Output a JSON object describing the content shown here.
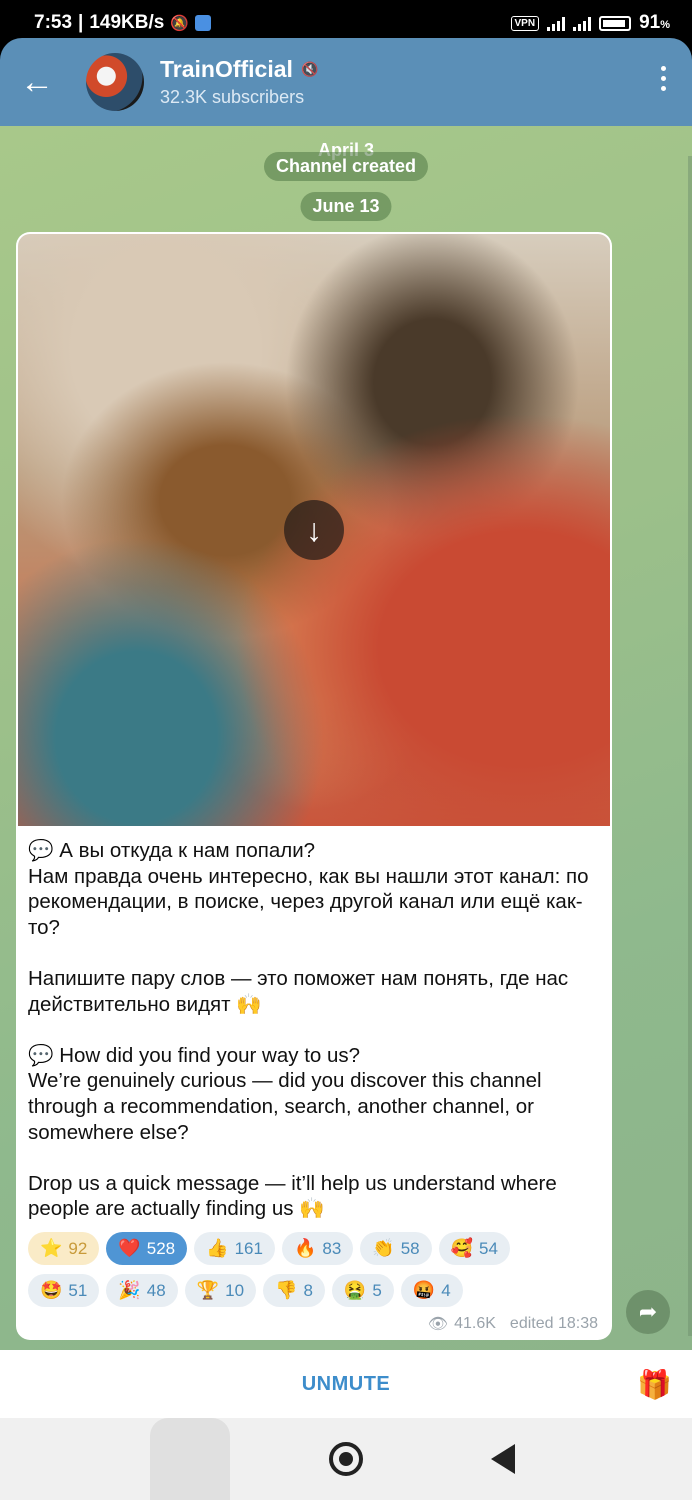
{
  "status_bar": {
    "time": "7:53",
    "speed": "149KB/s",
    "vpn": "VPN",
    "battery": "91"
  },
  "header": {
    "back_icon": "arrow-left-icon",
    "channel_name": "TrainOfficial",
    "subscribers": "32.3K subscribers",
    "menu_icon": "more-vert-icon"
  },
  "chat": {
    "service_1": "April 3",
    "service_2": "Channel created",
    "date_pill": "June 13",
    "post": {
      "para_ru_1": "💬 А вы откуда к нам попали?\nНам правда очень интересно, как вы нашли этот канал: по рекомендации, в поиске, через другой канал или ещё как-то?",
      "para_ru_2": "Напишите пару слов — это поможет нам понять, где нас действительно видят 🙌",
      "para_en_1": "💬 How did you find your way to us?\nWe’re genuinely curious — did you discover this channel through a recommendation, search, another channel, or somewhere else?",
      "para_en_2": "Drop us a quick message — it’ll help us understand where people are actually finding us 🙌",
      "reactions_row1": [
        {
          "emoji": "⭐",
          "count": "92"
        },
        {
          "emoji": "❤️",
          "count": "528"
        },
        {
          "emoji": "👍",
          "count": "161"
        },
        {
          "emoji": "🔥",
          "count": "83"
        },
        {
          "emoji": "👏",
          "count": "58"
        },
        {
          "emoji": "🥰",
          "count": "54"
        }
      ],
      "reactions_row2": [
        {
          "emoji": "🤩",
          "count": "51"
        },
        {
          "emoji": "🎉",
          "count": "48"
        },
        {
          "emoji": "🏆",
          "count": "10"
        },
        {
          "emoji": "👎",
          "count": "8"
        },
        {
          "emoji": "🤮",
          "count": "5"
        },
        {
          "emoji": "🤬",
          "count": "4"
        }
      ],
      "views": "41.6K",
      "edited": "edited 18:38"
    }
  },
  "bottom": {
    "unmute": "UNMUTE",
    "gift_icon": "gift-icon"
  }
}
